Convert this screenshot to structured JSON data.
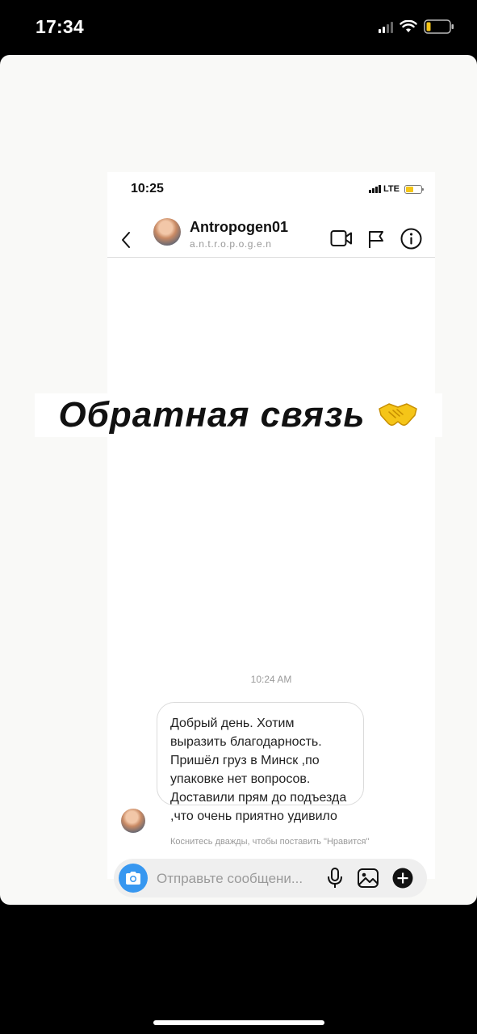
{
  "outer_status": {
    "time": "17:34"
  },
  "inner_status": {
    "time": "10:25",
    "network": "LTE"
  },
  "header": {
    "username": "Antropogen01",
    "handle": "a.n.t.r.o.p.o.g.e.n"
  },
  "overlay": {
    "title": "Обратная связь"
  },
  "chat": {
    "timestamp": "10:24 AM",
    "message": "Добрый день. Хотим выразить благодарность. Пришёл груз в Минск ,по упаковке нет вопросов. Доставили прям до подъезда ,что очень приятно удивило",
    "like_hint": "Коснитесь дважды, чтобы поставить \"Нравится\""
  },
  "composer": {
    "placeholder": "Отправьте сообщени..."
  },
  "colors": {
    "camera_button": "#3797f0",
    "battery_outer": "#f5c518",
    "handshake": "#f5c518"
  },
  "icons": [
    "back-chevron-icon",
    "video-call-icon",
    "flag-icon",
    "info-icon",
    "camera-icon",
    "microphone-icon",
    "gallery-icon",
    "plus-icon",
    "handshake-icon"
  ]
}
